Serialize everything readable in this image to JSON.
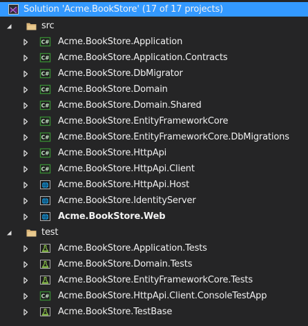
{
  "solution": {
    "label": "Solution 'Acme.BookStore' (17 of 17 projects)",
    "icon": "visual-studio-solution-icon"
  },
  "folders": [
    {
      "name": "src",
      "expanded": true,
      "icon": "folder-icon",
      "projects": [
        {
          "label": "Acme.BookStore.Application",
          "icon": "csharp-project-icon",
          "bold": false
        },
        {
          "label": "Acme.BookStore.Application.Contracts",
          "icon": "csharp-project-icon",
          "bold": false
        },
        {
          "label": "Acme.BookStore.DbMigrator",
          "icon": "csharp-project-icon",
          "bold": false
        },
        {
          "label": "Acme.BookStore.Domain",
          "icon": "csharp-project-icon",
          "bold": false
        },
        {
          "label": "Acme.BookStore.Domain.Shared",
          "icon": "csharp-project-icon",
          "bold": false
        },
        {
          "label": "Acme.BookStore.EntityFrameworkCore",
          "icon": "csharp-project-icon",
          "bold": false
        },
        {
          "label": "Acme.BookStore.EntityFrameworkCore.DbMigrations",
          "icon": "csharp-project-icon",
          "bold": false
        },
        {
          "label": "Acme.BookStore.HttpApi",
          "icon": "csharp-project-icon",
          "bold": false
        },
        {
          "label": "Acme.BookStore.HttpApi.Client",
          "icon": "csharp-project-icon",
          "bold": false
        },
        {
          "label": "Acme.BookStore.HttpApi.Host",
          "icon": "web-project-icon",
          "bold": false
        },
        {
          "label": "Acme.BookStore.IdentityServer",
          "icon": "web-project-icon",
          "bold": false
        },
        {
          "label": "Acme.BookStore.Web",
          "icon": "web-project-icon",
          "bold": true
        }
      ]
    },
    {
      "name": "test",
      "expanded": true,
      "icon": "folder-icon",
      "projects": [
        {
          "label": "Acme.BookStore.Application.Tests",
          "icon": "test-project-icon",
          "bold": false
        },
        {
          "label": "Acme.BookStore.Domain.Tests",
          "icon": "test-project-icon",
          "bold": false
        },
        {
          "label": "Acme.BookStore.EntityFrameworkCore.Tests",
          "icon": "test-project-icon",
          "bold": false
        },
        {
          "label": "Acme.BookStore.HttpApi.Client.ConsoleTestApp",
          "icon": "csharp-project-icon",
          "bold": false
        },
        {
          "label": "Acme.BookStore.TestBase",
          "icon": "test-project-icon",
          "bold": false
        }
      ]
    }
  ],
  "colors": {
    "background": "#252526",
    "selection": "#3399ff",
    "text": "#f1f1f1",
    "folder": "#dcb67a",
    "csharp": "#388a34",
    "web": "#1ba1e2",
    "test": "#8bc34a",
    "solution": "#68217a"
  }
}
